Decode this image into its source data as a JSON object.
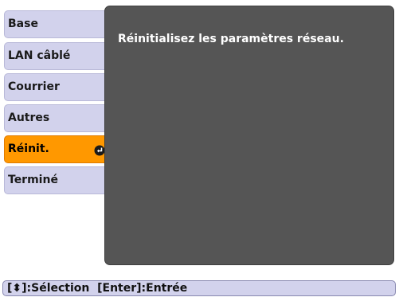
{
  "menu": {
    "items": [
      {
        "label": "Base"
      },
      {
        "label": "LAN câblé"
      },
      {
        "label": "Courrier"
      },
      {
        "label": "Autres"
      },
      {
        "label": "Réinit.",
        "active": true,
        "icon": "enter-icon"
      },
      {
        "label": "Terminé"
      }
    ]
  },
  "panel": {
    "message": "Réinitialisez les paramètres réseau."
  },
  "statusbar": {
    "hint": "[⬍]:Sélection  [Enter]:Entrée"
  },
  "colors": {
    "menu_bg": "#d2d2ec",
    "active_bg": "#ff9800",
    "panel_bg": "#555555"
  }
}
